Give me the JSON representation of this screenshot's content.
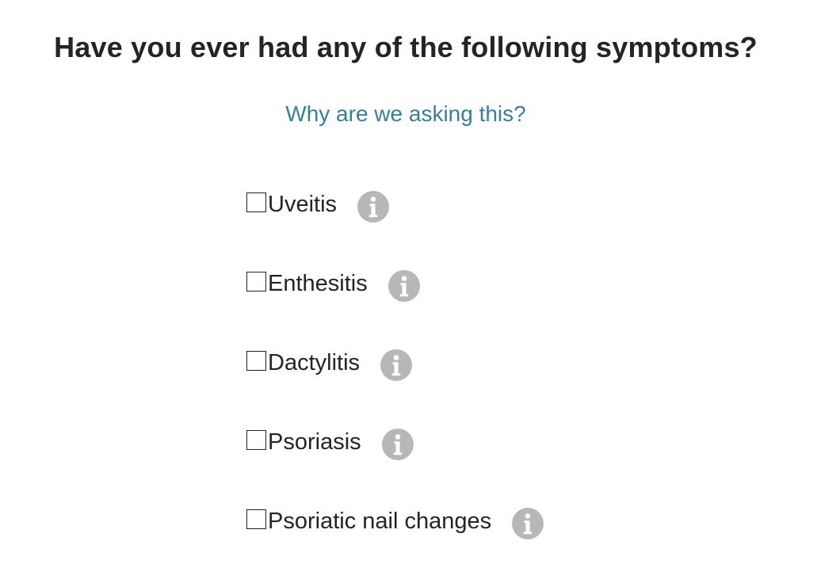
{
  "question": {
    "title": "Have you ever had any of the following symptoms?",
    "why_link": "Why are we asking this?"
  },
  "options": [
    {
      "label": "Uveitis",
      "checked": false,
      "icon": "info-icon"
    },
    {
      "label": "Enthesitis",
      "checked": false,
      "icon": "info-icon"
    },
    {
      "label": "Dactylitis",
      "checked": false,
      "icon": "info-icon"
    },
    {
      "label": "Psoriasis",
      "checked": false,
      "icon": "info-icon"
    },
    {
      "label": "Psoriatic nail changes",
      "checked": false,
      "icon": "info-icon"
    }
  ],
  "colors": {
    "link": "#3a7d99",
    "info_icon_bg": "#b7b7b7",
    "text": "#222426"
  }
}
